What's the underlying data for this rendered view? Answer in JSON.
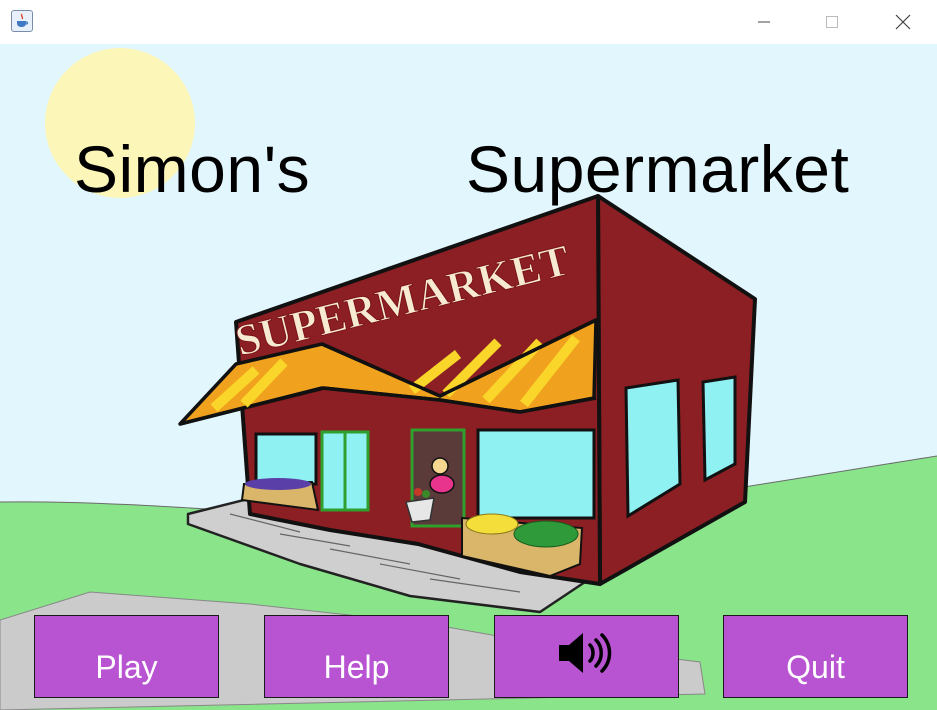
{
  "window": {
    "app_icon": "java-cup-icon",
    "controls": [
      "minimize-icon",
      "maximize-icon",
      "close-icon"
    ]
  },
  "scene": {
    "title_left": "Simon's",
    "title_right": "Supermarket",
    "store_sign": "SUPERMARKET",
    "colors": {
      "sky": "#e2f7fd",
      "sun": "#fcf6b8",
      "grass": "#89e48a",
      "building": "#8c1f23",
      "awning": "#f0a21e",
      "window": "#8ff1f2",
      "pavement": "#c9c9c9"
    }
  },
  "buttons": {
    "play": "Play",
    "help": "Help",
    "sound_icon": "speaker-volume-icon",
    "quit": "Quit",
    "color": "#b854d2"
  }
}
